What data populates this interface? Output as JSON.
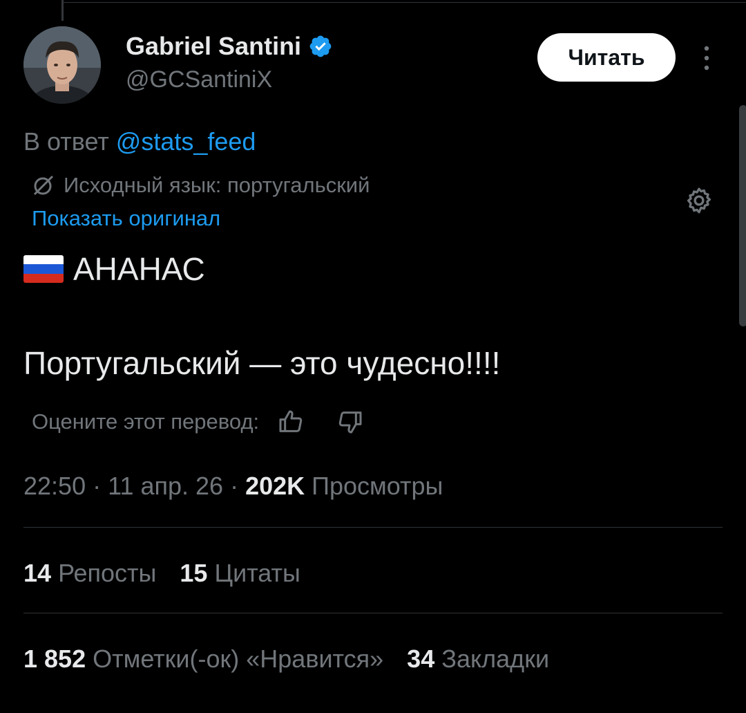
{
  "author": {
    "display_name": "Gabriel Santini",
    "handle": "@GCSantiniX",
    "follow_label": "Читать"
  },
  "reply": {
    "prefix": "В ответ",
    "mention": "@stats_feed"
  },
  "translation": {
    "source_language": "Исходный язык: португальский",
    "show_original": "Показать оригинал",
    "rate_prompt": "Оцените этот перевод:"
  },
  "tweet": {
    "line1": "АНАНАС",
    "line2": "Португальский — это чудесно!!!!"
  },
  "meta": {
    "time": "22:50",
    "date": "11 апр. 26",
    "views_count": "202K",
    "views_label": "Просмотры"
  },
  "stats": {
    "reposts_count": "14",
    "reposts_label": "Репосты",
    "quotes_count": "15",
    "quotes_label": "Цитаты",
    "likes_count": "1 852",
    "likes_label": "Отметки(-ок) «Нравится»",
    "bookmarks_count": "34",
    "bookmarks_label": "Закладки"
  },
  "colors": {
    "background": "#000000",
    "text_primary": "#e7e9ea",
    "text_secondary": "#71767b",
    "accent": "#1d9bf0",
    "divider": "#2f3336"
  },
  "icons": [
    "verified-badge-icon",
    "more-options-icon",
    "translate-icon",
    "settings-gear-icon",
    "thumbs-up-icon",
    "thumbs-down-icon",
    "russia-flag-icon"
  ]
}
